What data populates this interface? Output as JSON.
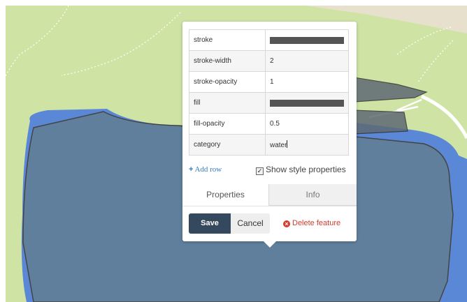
{
  "map": {
    "land_color": "#cfe3a4",
    "water_color": "#5b88d6",
    "feature_fill": "#5f7f9c",
    "feature_stroke": "#444444"
  },
  "popup": {
    "properties": [
      {
        "key": "stroke",
        "kind": "color",
        "value": "#555555"
      },
      {
        "key": "stroke-width",
        "kind": "text",
        "value": "2"
      },
      {
        "key": "stroke-opacity",
        "kind": "text",
        "value": "1"
      },
      {
        "key": "fill",
        "kind": "color",
        "value": "#555555"
      },
      {
        "key": "fill-opacity",
        "kind": "text",
        "value": "0.5"
      },
      {
        "key": "category",
        "kind": "text",
        "value": "water"
      }
    ],
    "add_row_icon": "plus-icon",
    "add_row_label": "Add row",
    "show_style_label": "Show style properties",
    "show_style_checked": true,
    "tabs": [
      "Properties",
      "Info"
    ],
    "active_tab": "Properties",
    "save_label": "Save",
    "cancel_label": "Cancel",
    "delete_icon": "times-circle-icon",
    "delete_label": "Delete feature"
  }
}
